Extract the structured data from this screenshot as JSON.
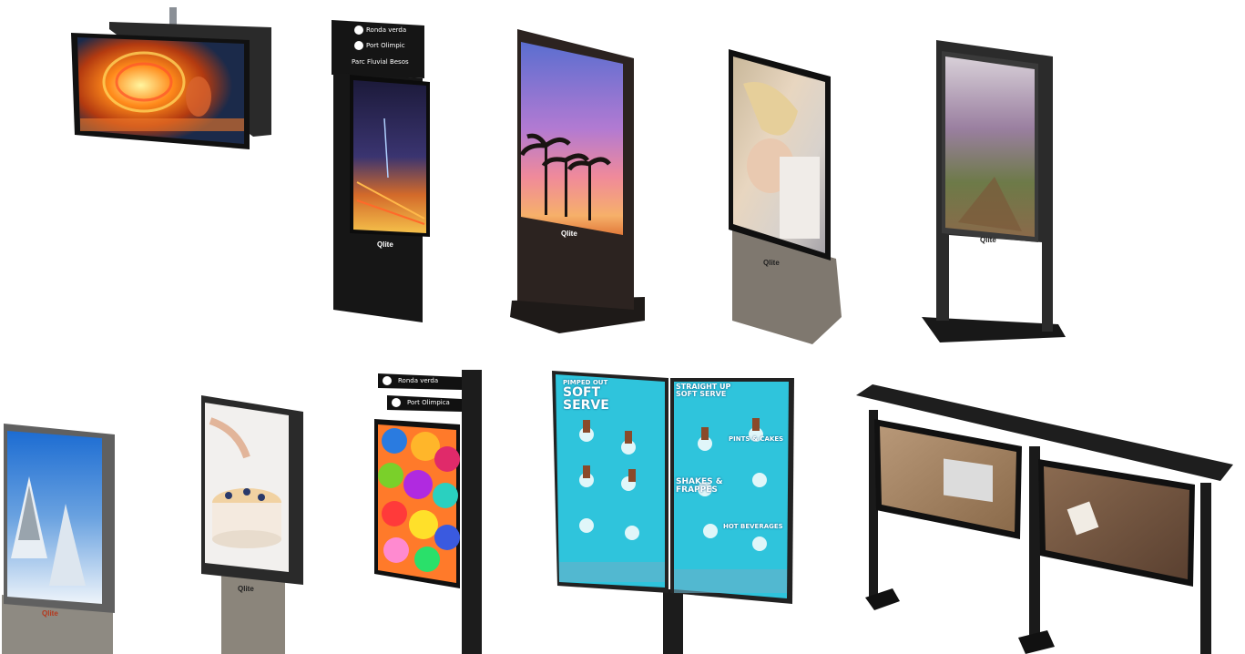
{
  "kiosks": {
    "k2": {
      "sign": [
        "Ronda verda",
        "Port Olimpic",
        "Parc Fluvial Besos"
      ]
    },
    "k7": {
      "sign": [
        "Ronda verda",
        "Port Olimpica"
      ]
    },
    "k8": {
      "left_menu": [
        "PIMPED OUT",
        "SOFT",
        "SERVE"
      ],
      "right_menu": [
        "STRAIGHT UP",
        "SOFT SERVE",
        "PINTS & CAKES",
        "SHAKES &",
        "FRAPPES",
        "HOT BEVERAGES"
      ]
    },
    "brand": "Qlite"
  },
  "colors": {
    "frame_black": "#1a1a1a",
    "base_grey": "#8b857b",
    "menu_cyan": "#2fc4dc"
  }
}
